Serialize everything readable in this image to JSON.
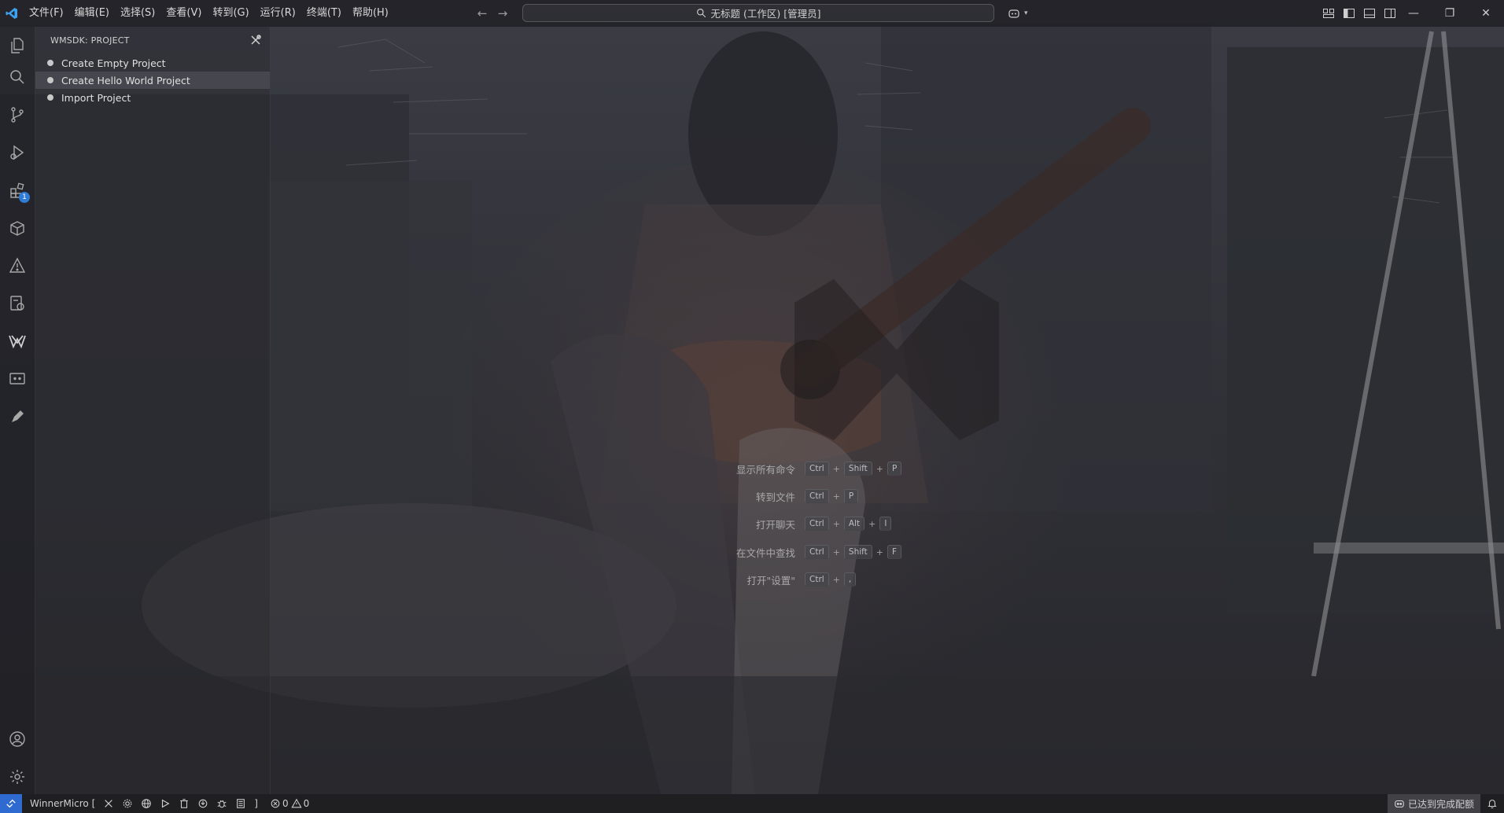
{
  "titlebar": {
    "menus": [
      "文件(F)",
      "编辑(E)",
      "选择(S)",
      "查看(V)",
      "转到(G)",
      "运行(R)",
      "终端(T)",
      "帮助(H)"
    ],
    "search_text": "无标题 (工作区) [管理员]",
    "icons": [
      "vscode-logo-icon",
      "arrow-left-icon",
      "arrow-right-icon",
      "search-icon",
      "copilot-icon",
      "customize-layout-icon",
      "toggle-primary-sidebar-icon",
      "toggle-panel-icon",
      "toggle-secondary-sidebar-icon"
    ],
    "window_controls": [
      "—",
      "❐",
      "✕"
    ]
  },
  "activitybar": {
    "icons": [
      "explorer-icon",
      "search-icon",
      "source-control-icon",
      "run-debug-icon",
      "extensions-icon",
      "package-icon",
      "warning-build-icon",
      "remote-explorer-icon",
      "wmsdk-icon",
      "monitor-icon",
      "pencil-icon",
      "account-icon",
      "settings-gear-icon"
    ],
    "extensions_badge": "1"
  },
  "sidebar": {
    "title": "WMSDK: PROJECT",
    "items": [
      {
        "label": "Create Empty Project"
      },
      {
        "label": "Create Hello World Project"
      },
      {
        "label": "Import Project"
      }
    ]
  },
  "editor": {
    "shortcuts": [
      {
        "label": "显示所有命令",
        "keys": [
          "Ctrl",
          "Shift",
          "P"
        ]
      },
      {
        "label": "转到文件",
        "keys": [
          "Ctrl",
          "P"
        ]
      },
      {
        "label": "打开聊天",
        "keys": [
          "Ctrl",
          "Alt",
          "I"
        ]
      },
      {
        "label": "在文件中查找",
        "keys": [
          "Ctrl",
          "Shift",
          "F"
        ]
      },
      {
        "label": "打开\"设置\"",
        "keys": [
          "Ctrl",
          ","
        ]
      }
    ]
  },
  "statusbar": {
    "project_label": "WinnerMicro [",
    "bracket_close": "]",
    "errors": "0",
    "warnings": "0",
    "quota_text": "已达到完成配额",
    "icons": [
      "remote-icon",
      "tools-icon",
      "gear-icon",
      "globe-icon",
      "run-icon",
      "trash-icon",
      "flash-icon",
      "debug-icon",
      "file-icon",
      "error-icon",
      "warning-icon",
      "copilot-icon",
      "bell-icon"
    ],
    "remote_color": "#2f6ad0"
  }
}
